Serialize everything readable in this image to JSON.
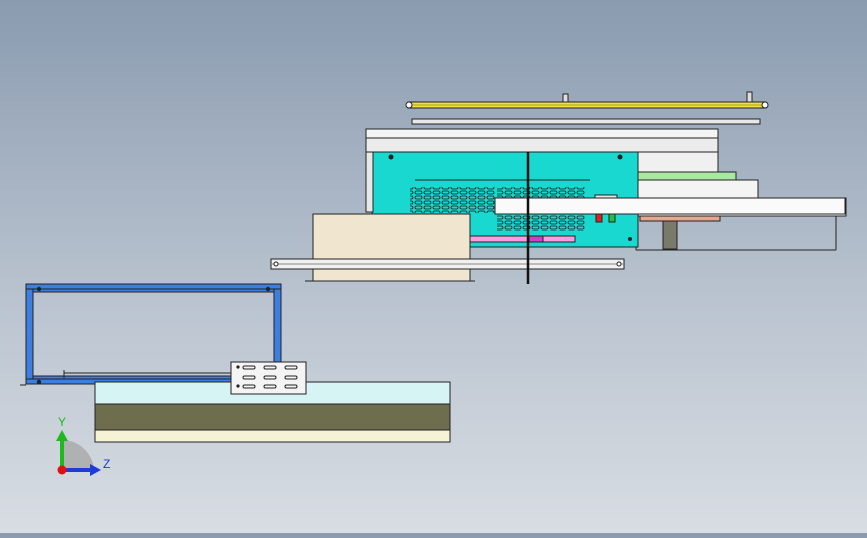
{
  "view": {
    "background_top": "#8a9bb0",
    "background_bottom": "#d8dde3"
  },
  "triad": {
    "y_label": "Y",
    "z_label": "Z",
    "y_color": "#1fb81f",
    "z_color": "#1e3cd8",
    "origin_color": "#e01010"
  },
  "colors": {
    "cabinet": "#18d8d0",
    "frame_blue": "#3d7fe0",
    "yellow_bar": "#f0e040",
    "beige_box": "#f0e6cf",
    "base_light": "#d6f4f4",
    "base_dark": "#6e6e4e",
    "base_cream": "#f6f2d6",
    "green_strip": "#a8e8a0",
    "salmon_strip": "#e8a890",
    "magenta_part": "#d040c0",
    "indicator_red": "#e02020",
    "indicator_green": "#20c040"
  }
}
